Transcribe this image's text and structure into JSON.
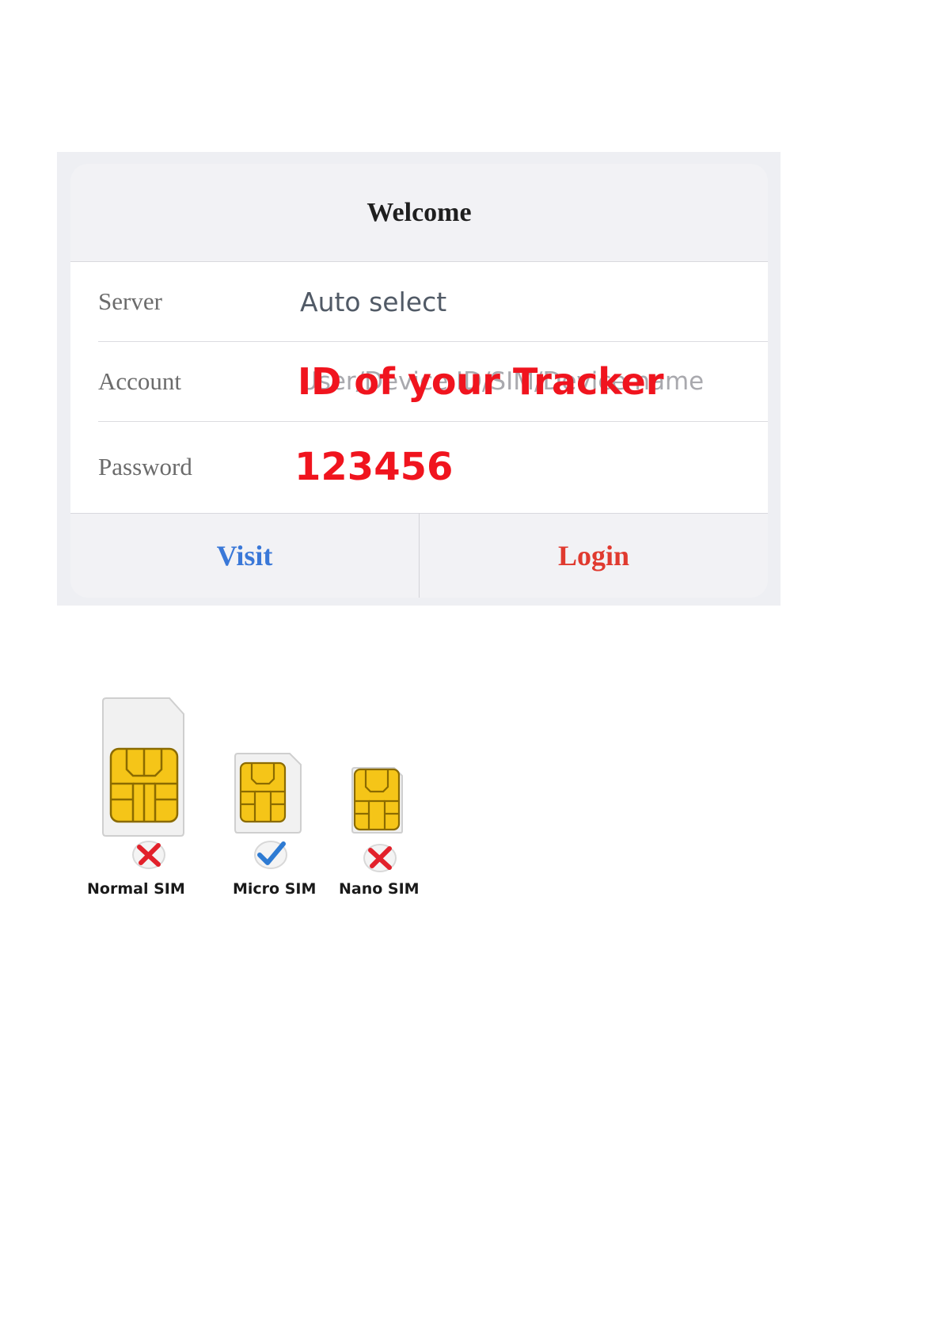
{
  "dialog": {
    "title": "Welcome",
    "rows": [
      {
        "label": "Server",
        "value": "Auto select"
      },
      {
        "label": "Account",
        "placeholder": "User/Device ID/SIM/Device name",
        "annotation": "ID of your Tracker"
      },
      {
        "label": "Password",
        "annotation": "123456"
      }
    ],
    "buttons": {
      "visit": "Visit",
      "login": "Login"
    }
  },
  "sims": [
    {
      "label": "Normal SIM",
      "status": "cross-icon"
    },
    {
      "label": "Micro SIM",
      "status": "check-icon"
    },
    {
      "label": "Nano SIM",
      "status": "cross-icon"
    }
  ],
  "colors": {
    "annotation": "#f0141e",
    "visit": "#3a78d8",
    "login": "#e03a2f",
    "chip": "#f5c518"
  }
}
